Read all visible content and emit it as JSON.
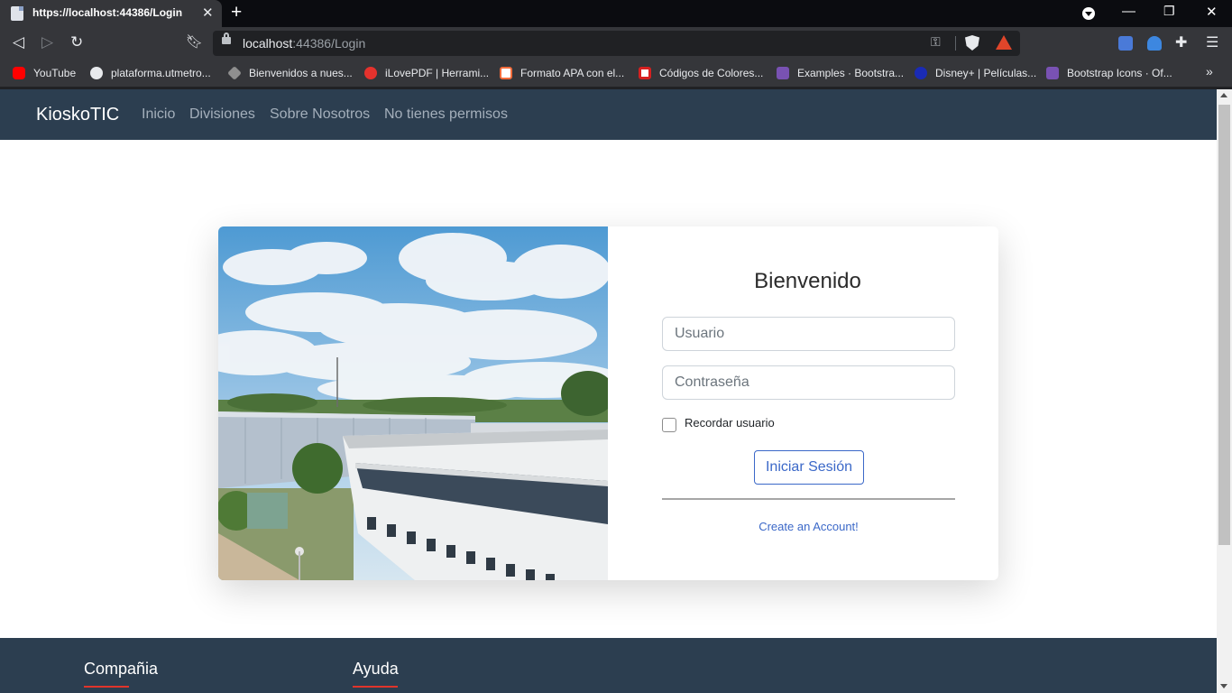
{
  "browser": {
    "tab_title": "https://localhost:44386/Login",
    "url_host": "localhost",
    "url_rest": ":44386/Login",
    "icons": [
      "back-icon",
      "forward-icon",
      "reload-icon",
      "bookmark-icon",
      "lock-icon",
      "key-icon",
      "brave-shield-icon",
      "brave-rewards-icon",
      "google-translate-icon",
      "extension-icon",
      "puzzle-icon",
      "menu-icon"
    ],
    "bookmarks": [
      {
        "label": "YouTube",
        "color": "#ff0000"
      },
      {
        "label": "plataforma.utmetro...",
        "color": "#e8eaed"
      },
      {
        "label": "Bienvenidos a nues...",
        "color": "#8f8f8f"
      },
      {
        "label": "iLovePDF | Herrami...",
        "color": "#e5322d"
      },
      {
        "label": "Formato APA con el...",
        "color": "#f26b3a"
      },
      {
        "label": "Códigos de Colores...",
        "color": "#d62020"
      },
      {
        "label": "Examples · Bootstra...",
        "color": "#7952b3"
      },
      {
        "label": "Disney+ | Películas...",
        "color": "#1a2bb5"
      },
      {
        "label": "Bootstrap Icons · Of...",
        "color": "#7952b3"
      }
    ]
  },
  "navbar": {
    "brand": "KioskoTIC",
    "links": [
      "Inicio",
      "Divisiones",
      "Sobre Nosotros",
      "No tienes permisos"
    ]
  },
  "login": {
    "title": "Bienvenido",
    "username_placeholder": "Usuario",
    "password_placeholder": "Contraseña",
    "remember_label": "Recordar usuario",
    "submit_label": "Iniciar Sesión",
    "create_account": "Create an Account!"
  },
  "footer": {
    "headings": [
      "Compañia",
      "Ayuda"
    ]
  },
  "colors": {
    "navbar_bg": "#2c3e50",
    "accent": "#3b68c8",
    "footer_underline": "#e0342b"
  }
}
